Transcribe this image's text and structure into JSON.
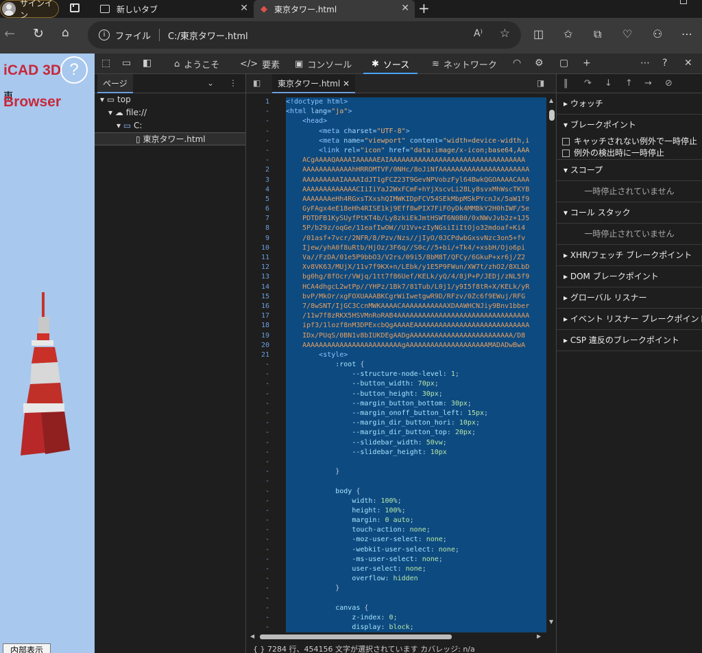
{
  "browser": {
    "signin": "サインイン",
    "tabs": [
      {
        "title": "新しいタブ"
      },
      {
        "title": "東京タワー.html"
      }
    ],
    "address": {
      "scheme_label": "ファイル",
      "url": "C:/東京タワー.html"
    }
  },
  "page": {
    "title_line1": "iCAD 3D",
    "title_line2": "Browser",
    "kanji": "東",
    "help": "?",
    "inner_button": "内部表示"
  },
  "devtools": {
    "tabs": [
      "ようこそ",
      "要素",
      "コンソール",
      "ソース",
      "ネットワーク"
    ],
    "navigator": {
      "tab": "ページ",
      "tree": [
        "top",
        "file://",
        "C:",
        "東京タワー.html"
      ]
    },
    "editor": {
      "file_tab": "東京タワー.html",
      "gutter": [
        "1",
        "-",
        "-",
        "-",
        "-",
        "-",
        "-",
        "2",
        "3",
        "4",
        "5",
        "6",
        "7",
        "8",
        "9",
        "10",
        "11",
        "12",
        "13",
        "14",
        "15",
        "16",
        "17",
        "18",
        "19",
        "20",
        "21",
        "-",
        "-",
        "-",
        "-",
        "-",
        "-",
        "-",
        "-",
        "-",
        "-",
        "-",
        "-",
        "-",
        "-",
        "-",
        "-",
        "-",
        "-",
        "-",
        "-",
        "-",
        "-",
        "-",
        "-",
        "-",
        "-",
        "-",
        "-",
        "-"
      ],
      "status": "{ }  7284 行、454156 文字が選択されています    カバレッジ: n/a"
    },
    "debugger": {
      "watch": "ウォッチ",
      "breakpoints": "ブレークポイント",
      "pause_uncaught": "キャッチされない例外で一時停止",
      "pause_caught": "例外の検出時に一時停止",
      "scope": "スコープ",
      "not_paused": "一時停止されていません",
      "call_stack": "コール スタック",
      "sections": [
        "XHR/フェッチ ブレークポイント",
        "DOM ブレークポイント",
        "グローバル リスナー",
        "イベント リスナー ブレークポイント",
        "CSP 違反のブレークポイント"
      ]
    }
  },
  "colors": {
    "page_bg": "#a8c8ee",
    "title_red": "#c8283a",
    "code_bg": "#0d4a80",
    "accent": "#4aa3ff"
  }
}
